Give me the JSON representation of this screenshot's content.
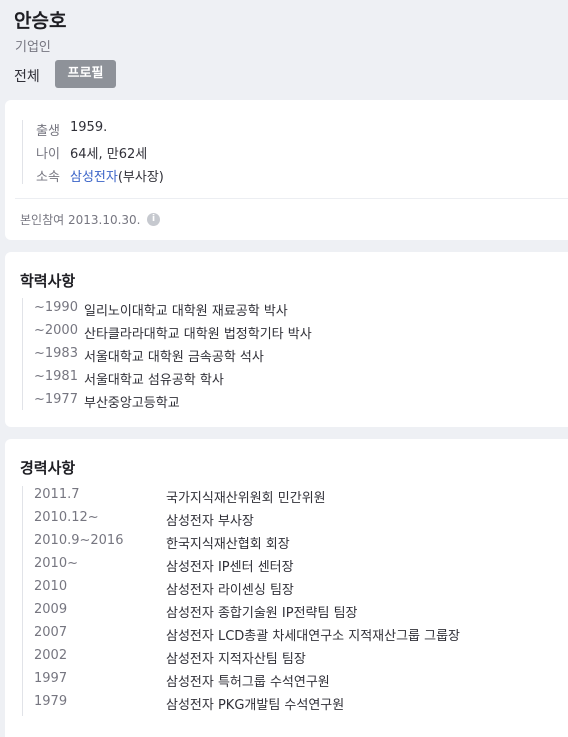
{
  "profile": {
    "name": "안승호",
    "occupation": "기업인",
    "tabs": {
      "all": "전체",
      "profile": "프로필"
    }
  },
  "basic": {
    "rows": [
      {
        "label": "출생",
        "value": "1959."
      },
      {
        "label": "나이",
        "value": "64세, 만62세"
      },
      {
        "label": "소속",
        "link": "삼성전자",
        "suffix": "(부사장)"
      }
    ],
    "verified": "본인참여 2013.10.30.",
    "info_icon": "i"
  },
  "education": {
    "title": "학력사항",
    "items": [
      {
        "year": "~1990",
        "text": "일리노이대학교 대학원 재료공학 박사"
      },
      {
        "year": "~2000",
        "text": "산타클라라대학교 대학원 법정학기타 박사"
      },
      {
        "year": "~1983",
        "text": "서울대학교 대학원 금속공학 석사"
      },
      {
        "year": "~1981",
        "text": "서울대학교 섬유공학 학사"
      },
      {
        "year": "~1977",
        "text": "부산중앙고등학교"
      }
    ]
  },
  "career": {
    "title": "경력사항",
    "items": [
      {
        "year": "2011.7",
        "text": "국가지식재산위원회 민간위원"
      },
      {
        "year": "2010.12~",
        "text": "삼성전자 부사장"
      },
      {
        "year": "2010.9~2016",
        "text": "한국지식재산협회 회장"
      },
      {
        "year": "2010~",
        "text": "삼성전자 IP센터 센터장"
      },
      {
        "year": "2010",
        "text": "삼성전자 라이센싱 팀장"
      },
      {
        "year": "2009",
        "text": "삼성전자 종합기술원 IP전략팀 팀장"
      },
      {
        "year": "2007",
        "text": "삼성전자 LCD총괄 차세대연구소 지적재산그룹 그룹장"
      },
      {
        "year": "2002",
        "text": "삼성전자 지적자산팀 팀장"
      },
      {
        "year": "1997",
        "text": "삼성전자 특허그룹 수석연구원"
      },
      {
        "year": "1979",
        "text": "삼성전자 PKG개발팀 수석연구원"
      }
    ]
  }
}
